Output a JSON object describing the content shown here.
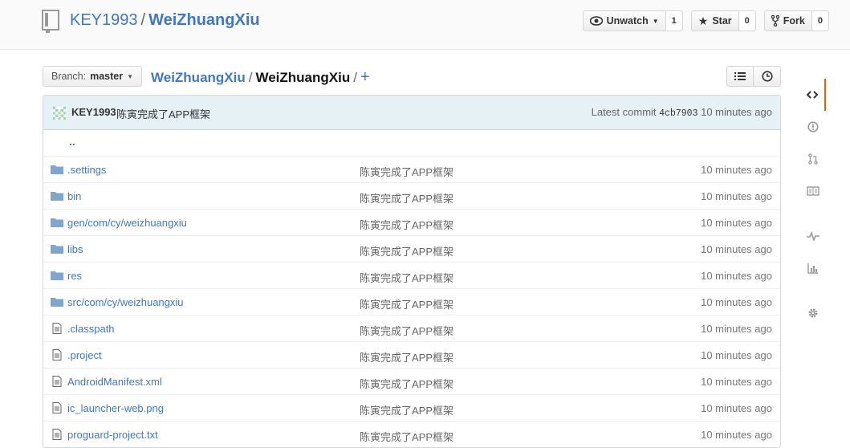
{
  "header": {
    "owner": "KEY1993",
    "separator": "/",
    "repo": "WeiZhuangXiu",
    "watch": {
      "label": "Unwatch",
      "count": "1"
    },
    "star": {
      "label": "Star",
      "count": "0"
    },
    "fork": {
      "label": "Fork",
      "count": "0"
    }
  },
  "file_nav": {
    "branch_prefix": "Branch:",
    "branch": "master",
    "crumb_root": "WeiZhuangXiu",
    "crumb_current": "WeiZhuangXiu",
    "plus": "+"
  },
  "commit": {
    "author": "KEY1993",
    "message": "陈寅完成了APP框架",
    "latest_label": "Latest commit",
    "sha": "4cb7903",
    "age": "10 minutes ago"
  },
  "files": {
    "up": "..",
    "rows": [
      {
        "type": "dir",
        "icon": "folder-icon",
        "name": ".settings",
        "message": "陈寅完成了APP框架",
        "age": "10 minutes ago"
      },
      {
        "type": "dir",
        "icon": "folder-icon",
        "name": "bin",
        "message": "陈寅完成了APP框架",
        "age": "10 minutes ago"
      },
      {
        "type": "dir",
        "icon": "folder-icon",
        "name": "gen/com/cy/weizhuangxiu",
        "message": "陈寅完成了APP框架",
        "age": "10 minutes ago"
      },
      {
        "type": "dir",
        "icon": "folder-icon",
        "name": "libs",
        "message": "陈寅完成了APP框架",
        "age": "10 minutes ago"
      },
      {
        "type": "dir",
        "icon": "folder-icon",
        "name": "res",
        "message": "陈寅完成了APP框架",
        "age": "10 minutes ago"
      },
      {
        "type": "dir",
        "icon": "folder-icon",
        "name": "src/com/cy/weizhuangxiu",
        "message": "陈寅完成了APP框架",
        "age": "10 minutes ago"
      },
      {
        "type": "file",
        "icon": "file-icon",
        "name": ".classpath",
        "message": "陈寅完成了APP框架",
        "age": "10 minutes ago"
      },
      {
        "type": "file",
        "icon": "file-icon",
        "name": ".project",
        "message": "陈寅完成了APP框架",
        "age": "10 minutes ago"
      },
      {
        "type": "file",
        "icon": "file-icon",
        "name": "AndroidManifest.xml",
        "message": "陈寅完成了APP框架",
        "age": "10 minutes ago"
      },
      {
        "type": "file",
        "icon": "file-icon",
        "name": "ic_launcher-web.png",
        "message": "陈寅完成了APP框架",
        "age": "10 minutes ago"
      },
      {
        "type": "file",
        "icon": "file-icon",
        "name": "proguard-project.txt",
        "message": "陈寅完成了APP框架",
        "age": "10 minutes ago"
      }
    ]
  },
  "colors": {
    "link": "#4078c0",
    "commit_bar": "#e6f1f6",
    "folder": "#80a6cd",
    "active_tab": "#d26911"
  }
}
